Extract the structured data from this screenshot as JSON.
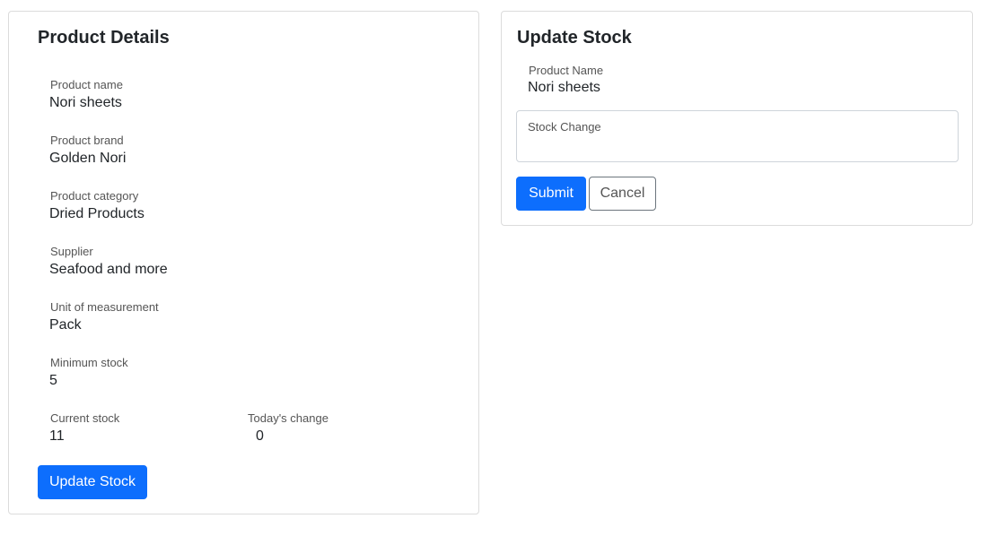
{
  "details": {
    "title": "Product Details",
    "fields": [
      {
        "label": "Product name",
        "value": "Nori sheets"
      },
      {
        "label": "Product brand",
        "value": "Golden Nori"
      },
      {
        "label": "Product category",
        "value": "Dried Products"
      },
      {
        "label": "Supplier",
        "value": "Seafood and more"
      },
      {
        "label": "Unit of measurement",
        "value": "Pack"
      },
      {
        "label": "Minimum stock",
        "value": "5"
      },
      {
        "label": "Current stock",
        "value": "11"
      },
      {
        "label": "Today's change",
        "value": "0"
      }
    ],
    "update_button": "Update Stock"
  },
  "update": {
    "title": "Update Stock",
    "product_name_label": "Product Name",
    "product_name_value": "Nori sheets",
    "stock_change_label": "Stock Change",
    "stock_change_value": "",
    "submit_label": "Submit",
    "cancel_label": "Cancel"
  }
}
